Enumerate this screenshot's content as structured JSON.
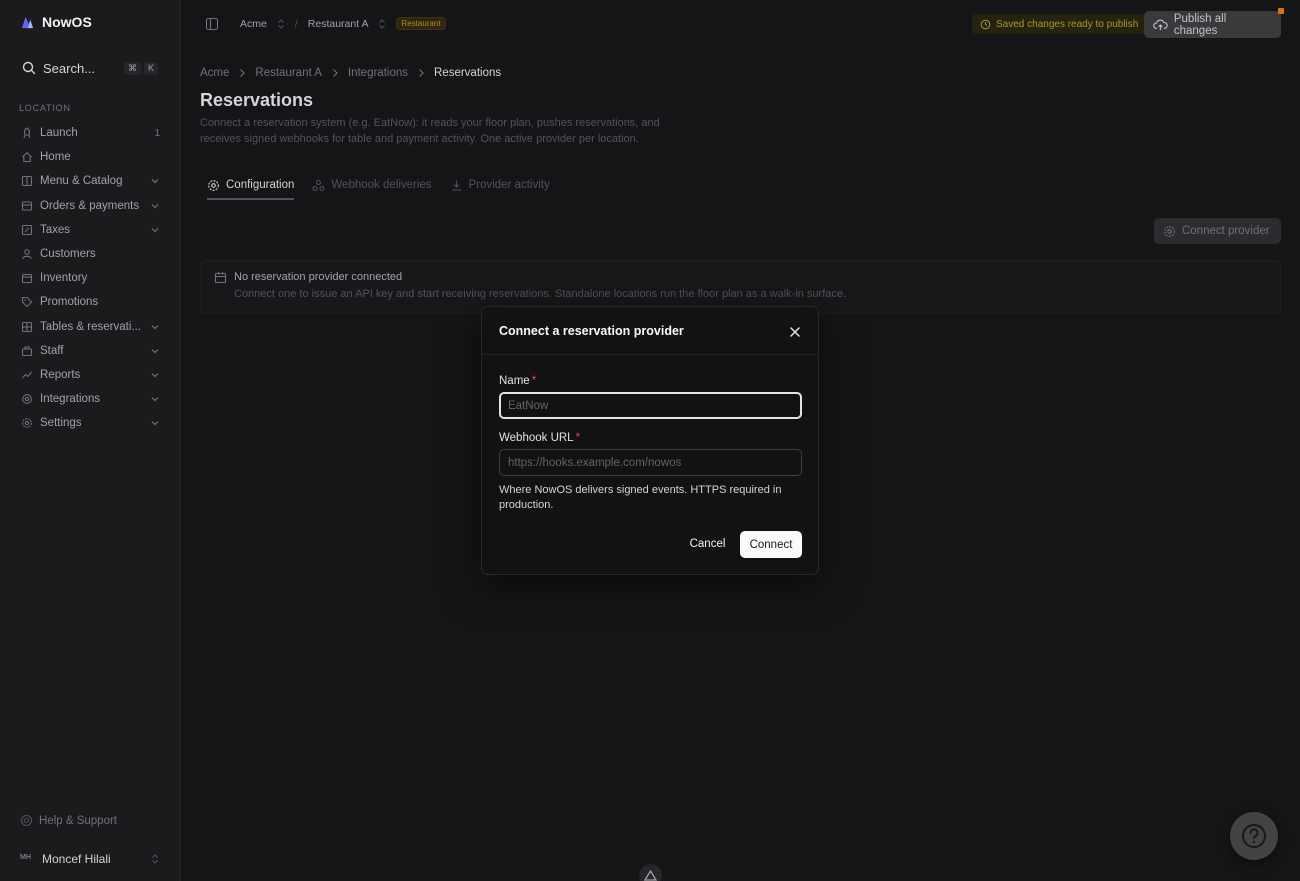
{
  "app": {
    "name": "NowOS"
  },
  "search": {
    "placeholder": "Search...",
    "kbd": [
      "⌘",
      "K"
    ]
  },
  "sidebar": {
    "section": "LOCATION",
    "items": [
      {
        "label": "Launch",
        "icon": "rocket-icon",
        "count": "1"
      },
      {
        "label": "Home",
        "icon": "home-icon"
      },
      {
        "label": "Menu & Catalog",
        "icon": "book-icon",
        "expandable": true
      },
      {
        "label": "Orders & payments",
        "icon": "receipt-icon",
        "expandable": true
      },
      {
        "label": "Taxes",
        "icon": "percent-icon",
        "expandable": true
      },
      {
        "label": "Customers",
        "icon": "user-icon"
      },
      {
        "label": "Inventory",
        "icon": "box-icon"
      },
      {
        "label": "Promotions",
        "icon": "tag-icon"
      },
      {
        "label": "Tables & reservati...",
        "icon": "table-icon",
        "expandable": true
      },
      {
        "label": "Staff",
        "icon": "staff-icon",
        "expandable": true
      },
      {
        "label": "Reports",
        "icon": "chart-icon",
        "expandable": true
      },
      {
        "label": "Integrations",
        "icon": "plug-icon",
        "expandable": true
      },
      {
        "label": "Settings",
        "icon": "gear-icon",
        "expandable": true
      }
    ],
    "help": "Help & Support",
    "user": {
      "initials": "MH",
      "name": "Moncef Hilali"
    }
  },
  "topbar": {
    "org": "Acme",
    "location": "Restaurant A",
    "badge": "Restaurant",
    "saved_status": "Saved changes ready to publish",
    "publish_label": "Publish all changes"
  },
  "breadcrumb": [
    "Acme",
    "Restaurant A",
    "Integrations",
    "Reservations"
  ],
  "page": {
    "title": "Reservations",
    "description": "Connect a reservation system (e.g. EatNow): it reads your floor plan, pushes reservations, and receives signed webhooks for table and payment activity. One active provider per location."
  },
  "tabs": [
    {
      "label": "Configuration",
      "icon": "gear-icon",
      "active": true
    },
    {
      "label": "Webhook deliveries",
      "icon": "webhook-icon"
    },
    {
      "label": "Provider activity",
      "icon": "download-icon"
    }
  ],
  "connect_button": "Connect provider",
  "empty_state": {
    "title": "No reservation provider connected",
    "subtitle": "Connect one to issue an API key and start receiving reservations. Standalone locations run the floor plan as a walk-in surface."
  },
  "modal": {
    "title": "Connect a reservation provider",
    "name_label": "Name",
    "name_placeholder": "EatNow",
    "url_label": "Webhook URL",
    "url_placeholder": "https://hooks.example.com/nowos",
    "help": "Where NowOS delivers signed events. HTTPS required in production.",
    "cancel": "Cancel",
    "connect": "Connect",
    "required_mark": "*"
  },
  "colors": {
    "accent": "#fafafa",
    "required": "#ef4444",
    "warning": "#a89a1e",
    "background": "#151517"
  }
}
